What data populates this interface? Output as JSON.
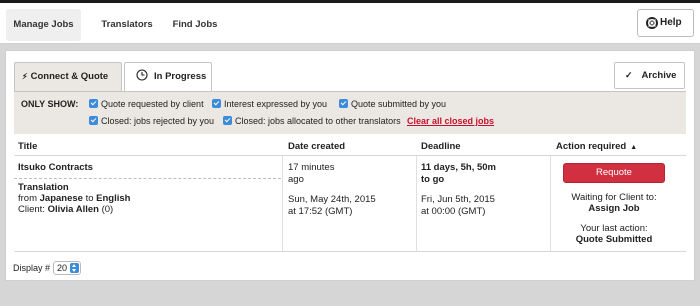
{
  "nav": {
    "tabs": [
      {
        "label": "Manage Jobs",
        "active": true
      },
      {
        "label": "Translators",
        "active": false
      },
      {
        "label": "Find Jobs",
        "active": false
      }
    ],
    "help_label": "Help",
    "help_icon": "lifebuoy-icon"
  },
  "tabs": {
    "connect_quote": "Connect & Quote",
    "in_progress": "In Progress",
    "archive": "Archive"
  },
  "filters": {
    "label": "ONLY SHOW:",
    "items": [
      {
        "label": "Quote requested by client",
        "checked": true
      },
      {
        "label": "Interest expressed by you",
        "checked": true
      },
      {
        "label": "Quote submitted by you",
        "checked": true
      },
      {
        "label": "Closed: jobs rejected by you",
        "checked": true
      },
      {
        "label": "Closed: jobs allocated to other translators",
        "checked": true
      }
    ],
    "clear_link": "Clear all closed jobs"
  },
  "table": {
    "headers": {
      "title": "Title",
      "date_created": "Date created",
      "deadline": "Deadline",
      "action_required": "Action required"
    },
    "rows": [
      {
        "job_name": "Itsuko Contracts",
        "service": "Translation",
        "from_prefix": "from",
        "source_lang": "Japanese",
        "to_word": "to",
        "target_lang": "English",
        "client_label": "Client:",
        "client_name": "Olivia Allen",
        "client_count": "(0)",
        "created_rel_1": "17 minutes",
        "created_rel_2": "ago",
        "created_abs_1": "Sun, May 24th, 2015",
        "created_abs_2": "at 17:52 (GMT)",
        "deadline_rel_1": "11 days, 5h, 50m",
        "deadline_rel_2": "to go",
        "deadline_abs_1": "Fri, Jun 5th, 2015",
        "deadline_abs_2": "at 00:00 (GMT)",
        "action_button": "Requote",
        "waiting_label": "Waiting for Client to:",
        "waiting_value": "Assign Job",
        "last_action_label": "Your last action:",
        "last_action_value": "Quote Submitted"
      }
    ]
  },
  "display": {
    "label": "Display #",
    "value": "20"
  },
  "colors": {
    "accent_red": "#d0303f",
    "filter_bg": "#ebe7e2",
    "checkbox_blue": "#3d8cd9"
  }
}
